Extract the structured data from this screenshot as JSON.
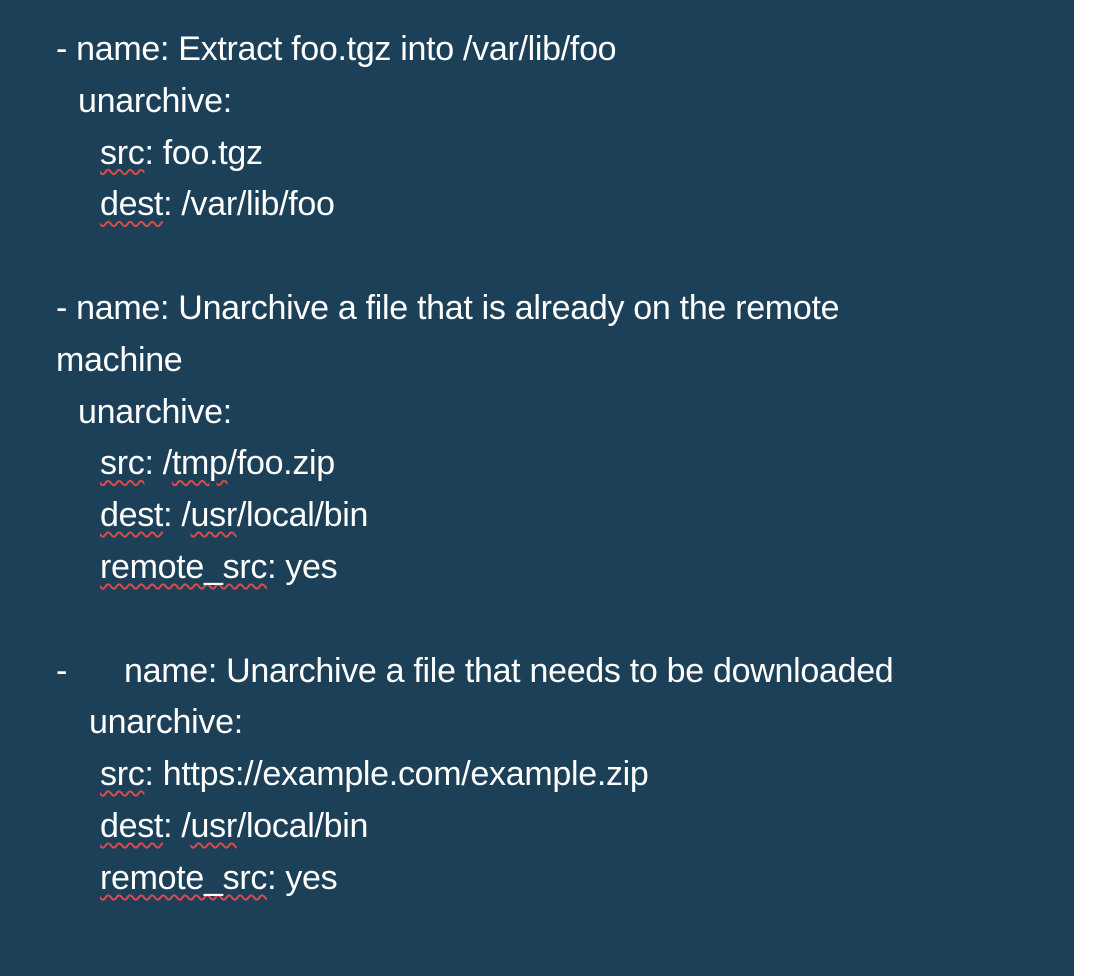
{
  "blocks": [
    {
      "name_line": "- name: Extract foo.tgz into /var/lib/foo",
      "module": "unarchive:",
      "params": [
        {
          "key": "src",
          "value": ": foo.tgz"
        },
        {
          "key": "dest",
          "value": ": /var/lib/foo"
        }
      ]
    },
    {
      "name_line": "- name: Unarchive a file that is already on the remote",
      "name_line_cont": "machine",
      "module": "unarchive:",
      "params": [
        {
          "key": "src",
          "value": ": /"
        },
        {
          "key": "tmp",
          "value": "/foo.zip"
        },
        {
          "key": "dest",
          "value": ": /"
        },
        {
          "key": "usr",
          "value": "/local/bin"
        },
        {
          "key": "remote_src",
          "value": ": yes"
        }
      ]
    },
    {
      "dash": "-",
      "name_line": "name: Unarchive a file that needs to be downloaded",
      "module": "unarchive:",
      "params": [
        {
          "key": "src",
          "value": ": https://example.com/example.zip"
        },
        {
          "key": "dest",
          "value": ": /"
        },
        {
          "key": "usr",
          "value": "/local/bin"
        },
        {
          "key": "remote_src",
          "value": ": yes"
        }
      ]
    }
  ]
}
